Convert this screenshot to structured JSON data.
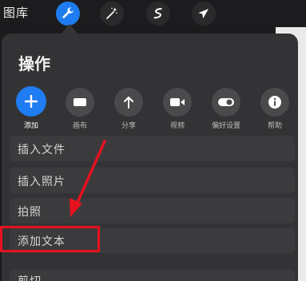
{
  "toolbar": {
    "gallery_label": "图库",
    "tools": [
      {
        "icon": "wrench-icon",
        "active": true
      },
      {
        "icon": "magic-wand-icon",
        "active": false
      },
      {
        "icon": "smudge-icon",
        "active": false
      },
      {
        "icon": "cursor-arrow-icon",
        "active": false
      }
    ]
  },
  "panel": {
    "title": "操作",
    "tabs": [
      {
        "label": "添加",
        "icon": "plus-icon",
        "active": true
      },
      {
        "label": "画布",
        "icon": "canvas-icon",
        "active": false
      },
      {
        "label": "分享",
        "icon": "share-arrow-icon",
        "active": false
      },
      {
        "label": "视频",
        "icon": "video-camera-icon",
        "active": false
      },
      {
        "label": "偏好设置",
        "icon": "toggle-icon",
        "active": false
      },
      {
        "label": "帮助",
        "icon": "info-icon",
        "active": false
      }
    ],
    "items": [
      {
        "label": "插入文件"
      },
      {
        "label": "插入照片"
      },
      {
        "label": "拍照"
      },
      {
        "label": "添加文本"
      },
      {
        "label": "剪切"
      }
    ]
  },
  "colors": {
    "accent": "#1f7cf2",
    "annotation": "#e5121e",
    "panel_bg": "#333335"
  }
}
